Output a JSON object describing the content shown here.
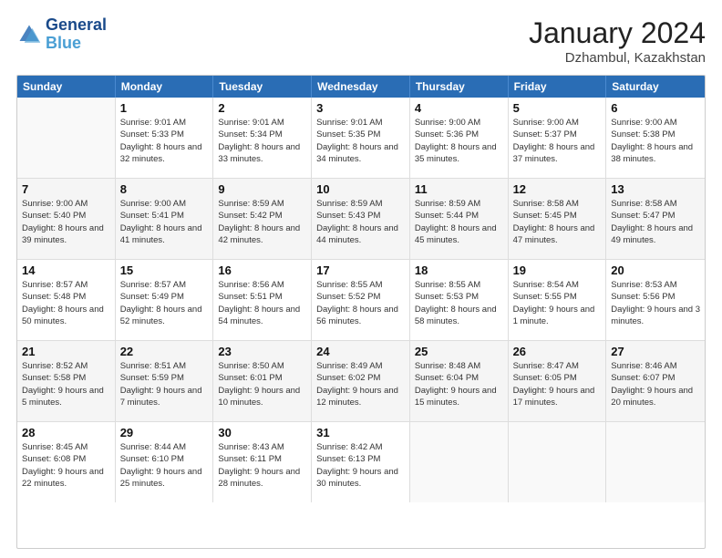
{
  "logo": {
    "line1": "General",
    "line2": "Blue"
  },
  "title": "January 2024",
  "subtitle": "Dzhambul, Kazakhstan",
  "days": [
    "Sunday",
    "Monday",
    "Tuesday",
    "Wednesday",
    "Thursday",
    "Friday",
    "Saturday"
  ],
  "weeks": [
    [
      {
        "day": "",
        "sunrise": "",
        "sunset": "",
        "daylight": ""
      },
      {
        "day": "1",
        "sunrise": "Sunrise: 9:01 AM",
        "sunset": "Sunset: 5:33 PM",
        "daylight": "Daylight: 8 hours and 32 minutes."
      },
      {
        "day": "2",
        "sunrise": "Sunrise: 9:01 AM",
        "sunset": "Sunset: 5:34 PM",
        "daylight": "Daylight: 8 hours and 33 minutes."
      },
      {
        "day": "3",
        "sunrise": "Sunrise: 9:01 AM",
        "sunset": "Sunset: 5:35 PM",
        "daylight": "Daylight: 8 hours and 34 minutes."
      },
      {
        "day": "4",
        "sunrise": "Sunrise: 9:00 AM",
        "sunset": "Sunset: 5:36 PM",
        "daylight": "Daylight: 8 hours and 35 minutes."
      },
      {
        "day": "5",
        "sunrise": "Sunrise: 9:00 AM",
        "sunset": "Sunset: 5:37 PM",
        "daylight": "Daylight: 8 hours and 37 minutes."
      },
      {
        "day": "6",
        "sunrise": "Sunrise: 9:00 AM",
        "sunset": "Sunset: 5:38 PM",
        "daylight": "Daylight: 8 hours and 38 minutes."
      }
    ],
    [
      {
        "day": "7",
        "sunrise": "Sunrise: 9:00 AM",
        "sunset": "Sunset: 5:40 PM",
        "daylight": "Daylight: 8 hours and 39 minutes."
      },
      {
        "day": "8",
        "sunrise": "Sunrise: 9:00 AM",
        "sunset": "Sunset: 5:41 PM",
        "daylight": "Daylight: 8 hours and 41 minutes."
      },
      {
        "day": "9",
        "sunrise": "Sunrise: 8:59 AM",
        "sunset": "Sunset: 5:42 PM",
        "daylight": "Daylight: 8 hours and 42 minutes."
      },
      {
        "day": "10",
        "sunrise": "Sunrise: 8:59 AM",
        "sunset": "Sunset: 5:43 PM",
        "daylight": "Daylight: 8 hours and 44 minutes."
      },
      {
        "day": "11",
        "sunrise": "Sunrise: 8:59 AM",
        "sunset": "Sunset: 5:44 PM",
        "daylight": "Daylight: 8 hours and 45 minutes."
      },
      {
        "day": "12",
        "sunrise": "Sunrise: 8:58 AM",
        "sunset": "Sunset: 5:45 PM",
        "daylight": "Daylight: 8 hours and 47 minutes."
      },
      {
        "day": "13",
        "sunrise": "Sunrise: 8:58 AM",
        "sunset": "Sunset: 5:47 PM",
        "daylight": "Daylight: 8 hours and 49 minutes."
      }
    ],
    [
      {
        "day": "14",
        "sunrise": "Sunrise: 8:57 AM",
        "sunset": "Sunset: 5:48 PM",
        "daylight": "Daylight: 8 hours and 50 minutes."
      },
      {
        "day": "15",
        "sunrise": "Sunrise: 8:57 AM",
        "sunset": "Sunset: 5:49 PM",
        "daylight": "Daylight: 8 hours and 52 minutes."
      },
      {
        "day": "16",
        "sunrise": "Sunrise: 8:56 AM",
        "sunset": "Sunset: 5:51 PM",
        "daylight": "Daylight: 8 hours and 54 minutes."
      },
      {
        "day": "17",
        "sunrise": "Sunrise: 8:55 AM",
        "sunset": "Sunset: 5:52 PM",
        "daylight": "Daylight: 8 hours and 56 minutes."
      },
      {
        "day": "18",
        "sunrise": "Sunrise: 8:55 AM",
        "sunset": "Sunset: 5:53 PM",
        "daylight": "Daylight: 8 hours and 58 minutes."
      },
      {
        "day": "19",
        "sunrise": "Sunrise: 8:54 AM",
        "sunset": "Sunset: 5:55 PM",
        "daylight": "Daylight: 9 hours and 1 minute."
      },
      {
        "day": "20",
        "sunrise": "Sunrise: 8:53 AM",
        "sunset": "Sunset: 5:56 PM",
        "daylight": "Daylight: 9 hours and 3 minutes."
      }
    ],
    [
      {
        "day": "21",
        "sunrise": "Sunrise: 8:52 AM",
        "sunset": "Sunset: 5:58 PM",
        "daylight": "Daylight: 9 hours and 5 minutes."
      },
      {
        "day": "22",
        "sunrise": "Sunrise: 8:51 AM",
        "sunset": "Sunset: 5:59 PM",
        "daylight": "Daylight: 9 hours and 7 minutes."
      },
      {
        "day": "23",
        "sunrise": "Sunrise: 8:50 AM",
        "sunset": "Sunset: 6:01 PM",
        "daylight": "Daylight: 9 hours and 10 minutes."
      },
      {
        "day": "24",
        "sunrise": "Sunrise: 8:49 AM",
        "sunset": "Sunset: 6:02 PM",
        "daylight": "Daylight: 9 hours and 12 minutes."
      },
      {
        "day": "25",
        "sunrise": "Sunrise: 8:48 AM",
        "sunset": "Sunset: 6:04 PM",
        "daylight": "Daylight: 9 hours and 15 minutes."
      },
      {
        "day": "26",
        "sunrise": "Sunrise: 8:47 AM",
        "sunset": "Sunset: 6:05 PM",
        "daylight": "Daylight: 9 hours and 17 minutes."
      },
      {
        "day": "27",
        "sunrise": "Sunrise: 8:46 AM",
        "sunset": "Sunset: 6:07 PM",
        "daylight": "Daylight: 9 hours and 20 minutes."
      }
    ],
    [
      {
        "day": "28",
        "sunrise": "Sunrise: 8:45 AM",
        "sunset": "Sunset: 6:08 PM",
        "daylight": "Daylight: 9 hours and 22 minutes."
      },
      {
        "day": "29",
        "sunrise": "Sunrise: 8:44 AM",
        "sunset": "Sunset: 6:10 PM",
        "daylight": "Daylight: 9 hours and 25 minutes."
      },
      {
        "day": "30",
        "sunrise": "Sunrise: 8:43 AM",
        "sunset": "Sunset: 6:11 PM",
        "daylight": "Daylight: 9 hours and 28 minutes."
      },
      {
        "day": "31",
        "sunrise": "Sunrise: 8:42 AM",
        "sunset": "Sunset: 6:13 PM",
        "daylight": "Daylight: 9 hours and 30 minutes."
      },
      {
        "day": "",
        "sunrise": "",
        "sunset": "",
        "daylight": ""
      },
      {
        "day": "",
        "sunrise": "",
        "sunset": "",
        "daylight": ""
      },
      {
        "day": "",
        "sunrise": "",
        "sunset": "",
        "daylight": ""
      }
    ]
  ]
}
